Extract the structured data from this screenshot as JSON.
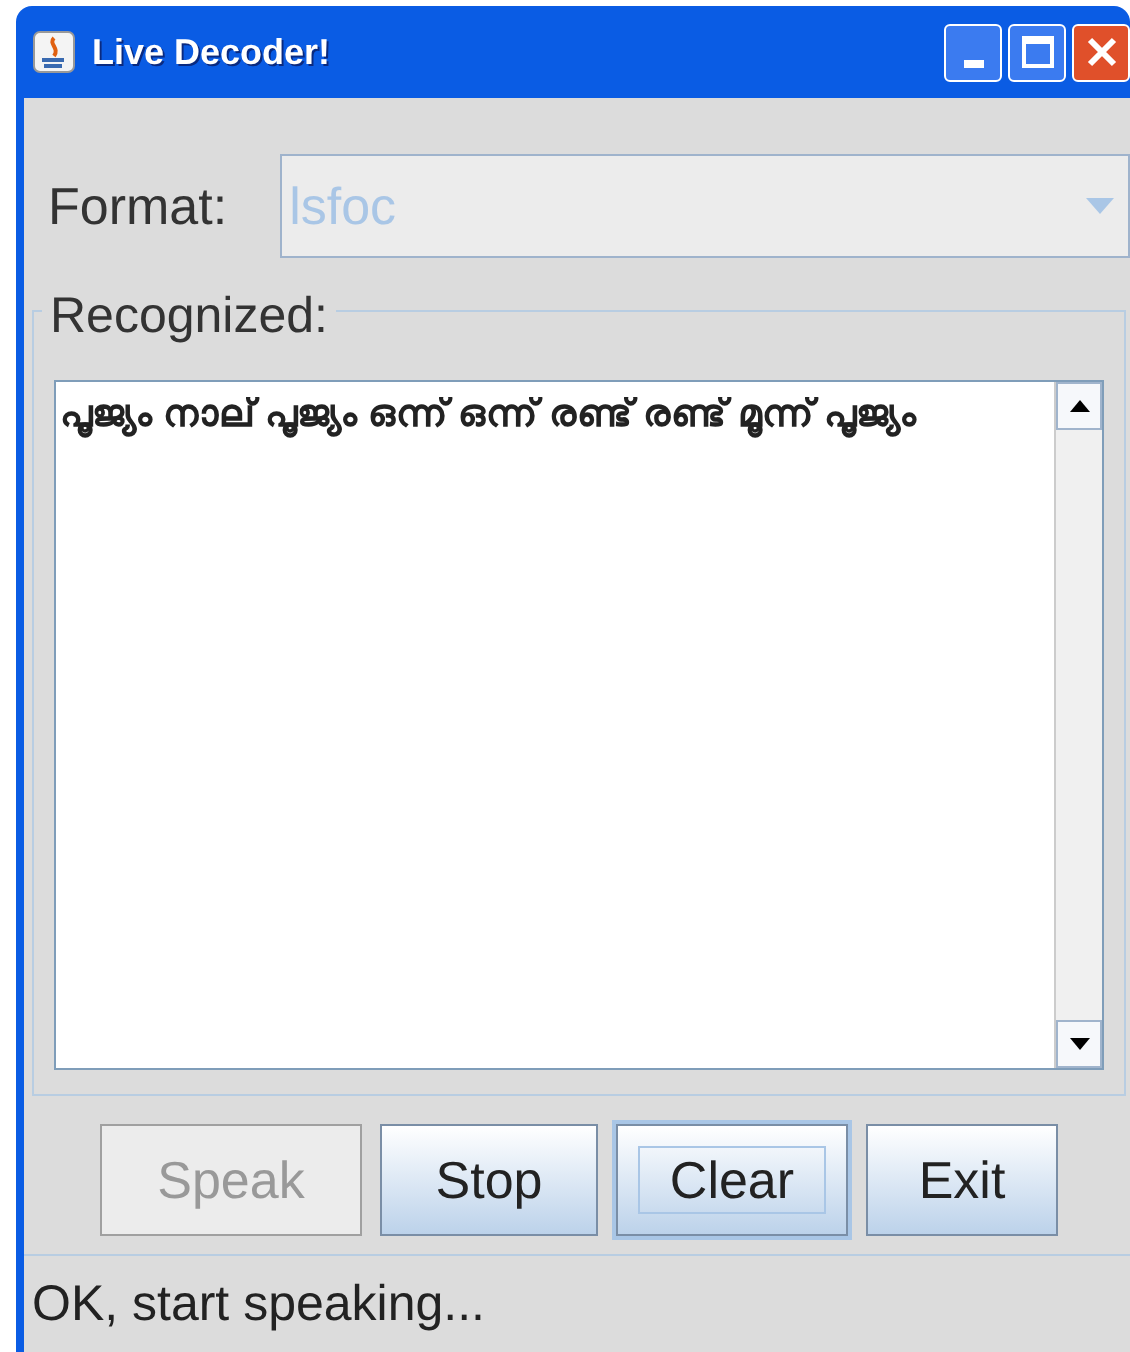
{
  "window": {
    "title": "Live Decoder!"
  },
  "format": {
    "label": "Format:",
    "value": "lsfoc",
    "disabled": true
  },
  "recognized": {
    "label": "Recognized:",
    "text": "പൂജ്യം നാല് പൂജ്യം ഒന്ന് ഒന്ന് രണ്ട് രണ്ട് മൂന്ന് പൂജ്യം"
  },
  "buttons": [
    {
      "label": "Speak",
      "disabled": true,
      "focused": false
    },
    {
      "label": "Stop",
      "disabled": false,
      "focused": false
    },
    {
      "label": "Clear",
      "disabled": false,
      "focused": true
    },
    {
      "label": "Exit",
      "disabled": false,
      "focused": false
    }
  ],
  "status_bar": "OK, start speaking..."
}
